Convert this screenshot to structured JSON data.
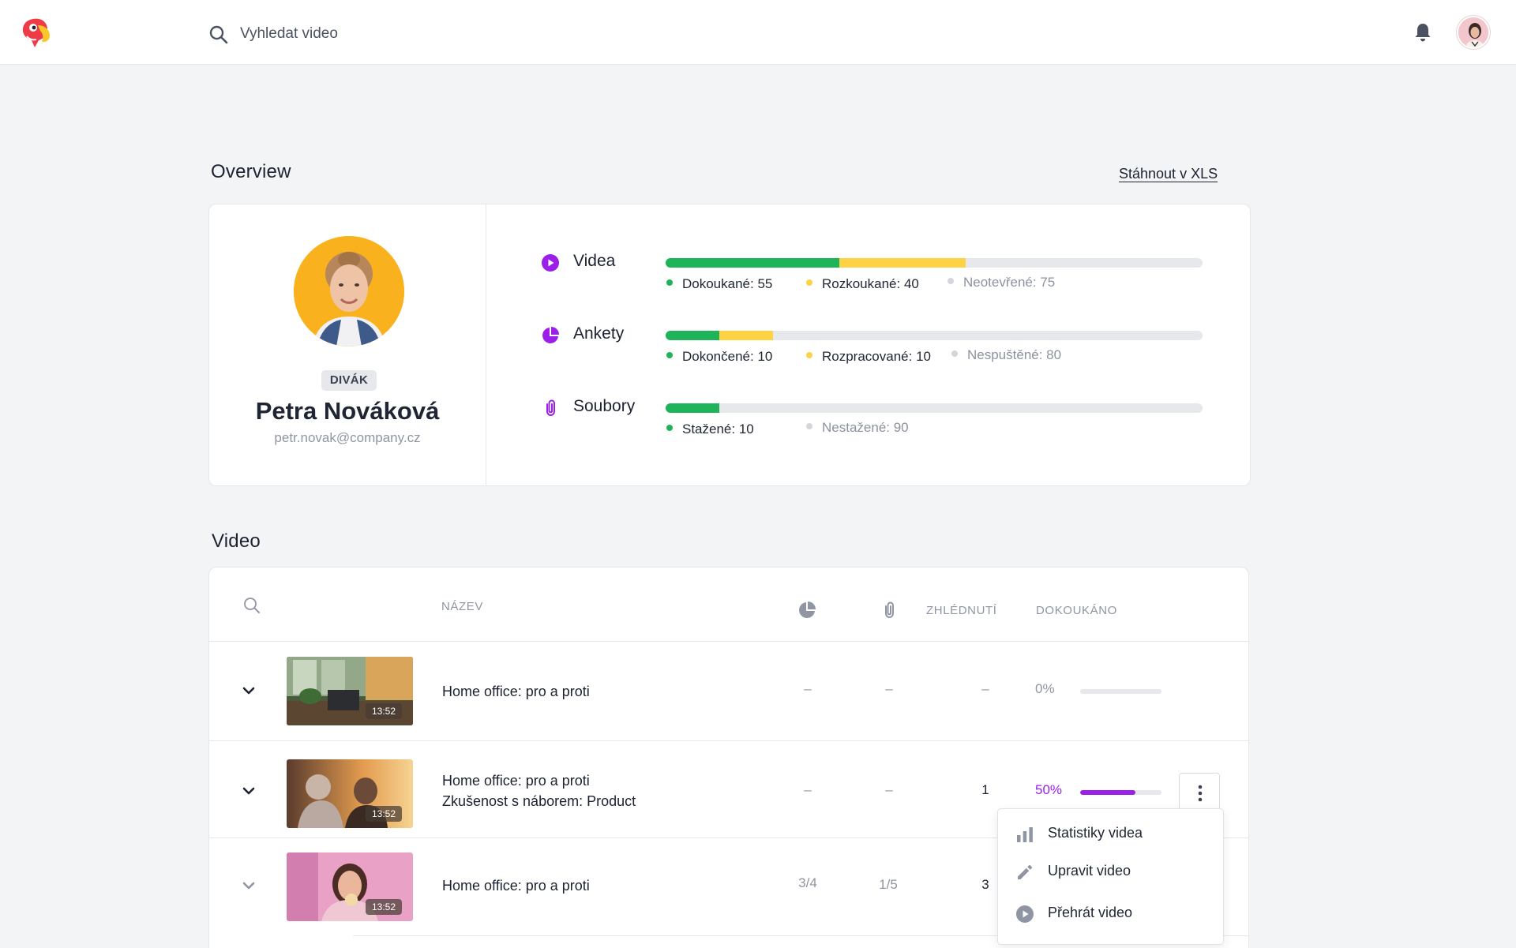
{
  "header": {
    "search_placeholder": "Vyhledat video",
    "logo_icon": "parrot-logo-icon",
    "notification_icon": "bell-icon"
  },
  "overview": {
    "title": "Overview",
    "download_label": "Stáhnout v XLS",
    "profile": {
      "role": "DIVÁK",
      "name": "Petra Nováková",
      "email": "petr.novak@company.cz"
    },
    "stats": [
      {
        "label": "Videa",
        "icon": "play-circle-icon",
        "segments": [
          {
            "label": "Dokoukané: 55",
            "value": 55,
            "color": "#1fb35a"
          },
          {
            "label": "Rozkoukané: 40",
            "value": 40,
            "color": "#fdd245"
          },
          {
            "label": "Neotevřené: 75",
            "value": 75,
            "color": "#e6e8ec"
          }
        ]
      },
      {
        "label": "Ankety",
        "icon": "pie-chart-icon",
        "segments": [
          {
            "label": "Dokončené: 10",
            "value": 10,
            "color": "#1fb35a"
          },
          {
            "label": "Rozpracované: 10",
            "value": 10,
            "color": "#fdd245"
          },
          {
            "label": "Nespuštěné: 80",
            "value": 80,
            "color": "#e6e8ec"
          }
        ]
      },
      {
        "label": "Soubory",
        "icon": "paperclip-icon",
        "segments": [
          {
            "label": "Stažené: 10",
            "value": 10,
            "color": "#1fb35a"
          },
          {
            "label": "Nestažené: 90",
            "value": 90,
            "color": "#e6e8ec"
          }
        ]
      }
    ],
    "colors": {
      "accent": "#9b1fe8",
      "done": "#1fb35a",
      "in_progress": "#fdd245",
      "empty": "#e6e8ec"
    }
  },
  "video": {
    "title": "Video",
    "columns": {
      "name": "NÁZEV",
      "polls_icon": "pie-chart-icon",
      "files_icon": "paperclip-icon",
      "views": "ZHLÉDNUTÍ",
      "completed": "DOKOUKÁNO"
    },
    "rows": [
      {
        "title": "Home office: pro a proti",
        "subtitle": "",
        "duration": "13:52",
        "polls": "–",
        "files": "–",
        "views": "–",
        "completed": "0%",
        "completed_fraction": 0
      },
      {
        "title": "Home office: pro a proti",
        "subtitle": "Zkušenost s náborem: Product",
        "duration": "13:52",
        "polls": "–",
        "files": "–",
        "views": "1",
        "completed": "50%",
        "completed_fraction": 0.68
      },
      {
        "title": "Home office: pro a proti",
        "subtitle": "",
        "duration": "13:52",
        "polls": "3/4",
        "files": "1/5",
        "views": "3",
        "completed": "",
        "completed_fraction": 0
      }
    ],
    "context_menu": [
      {
        "label": "Statistiky videa",
        "icon": "bar-chart-icon"
      },
      {
        "label": "Upravit video",
        "icon": "pencil-icon"
      },
      {
        "label": "Přehrát video",
        "icon": "play-circle-icon"
      }
    ]
  }
}
